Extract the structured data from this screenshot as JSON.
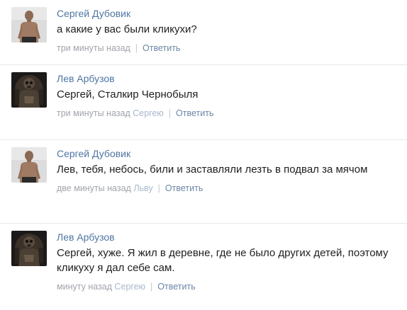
{
  "comments": [
    {
      "author": "Сергей Дубовик",
      "text": "а какие у вас были кликухи?",
      "time": "три минуты назад",
      "reply_to": "",
      "reply": "Ответить",
      "avatar": "avatar-shirtless-man"
    },
    {
      "author": "Лев Арбузов",
      "text": "Сергей, Сталкир Чернобыля",
      "time": "три минуты назад",
      "reply_to": "Сергею",
      "reply": "Ответить",
      "avatar": "avatar-stalker-soldier"
    },
    {
      "author": "Сергей Дубовик",
      "text": "Лев, тебя, небось, били и заставляли лезть в подвал за мячом",
      "time": "две минуты назад",
      "reply_to": "Льву",
      "reply": "Ответить",
      "avatar": "avatar-shirtless-man"
    },
    {
      "author": "Лев Арбузов",
      "text": "Сергей, хуже. Я жил в деревне, где не было других детей, поэтому кликуху я дал себе сам.",
      "time": "минуту назад",
      "reply_to": "Сергею",
      "reply": "Ответить",
      "avatar": "avatar-stalker-soldier"
    }
  ],
  "colors": {
    "author": "#4f76a4",
    "text": "#1e1e1e",
    "meta": "#a0a4aa",
    "reply": "#6c86a6",
    "divider": "#e6e8eb"
  }
}
